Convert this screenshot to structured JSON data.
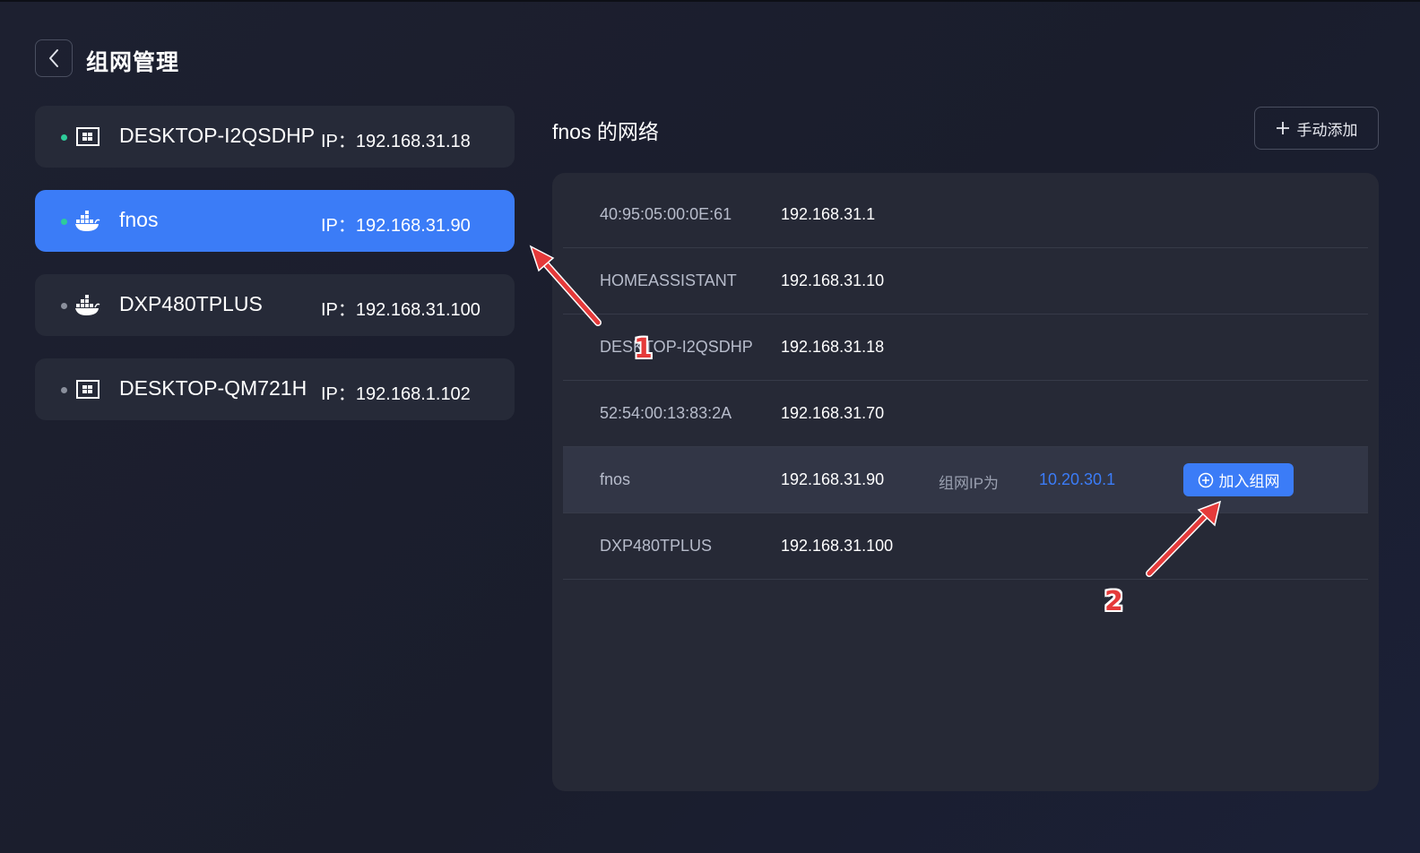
{
  "header": {
    "title": "组网管理"
  },
  "devices": [
    {
      "name": "DESKTOP-I2QSDHP",
      "ip_label": "IP：",
      "ip": "192.168.31.18",
      "icon": "windows-pc-icon",
      "status": "online",
      "active": false
    },
    {
      "name": "fnos",
      "ip_label": "IP：",
      "ip": "192.168.31.90",
      "icon": "docker-whale-icon",
      "status": "online",
      "active": true
    },
    {
      "name": "DXP480TPLUS",
      "ip_label": "IP：",
      "ip": "192.168.31.100",
      "icon": "docker-whale-icon",
      "status": "offline",
      "active": false
    },
    {
      "name": "DESKTOP-QM721H",
      "ip_label": "IP：",
      "ip": "192.168.1.102",
      "icon": "windows-pc-icon",
      "status": "offline",
      "active": false
    }
  ],
  "network": {
    "title": "fnos 的网络",
    "add_button": "手动添加",
    "rows": [
      {
        "name": "40:95:05:00:0E:61",
        "ip": "192.168.31.1"
      },
      {
        "name": "HOMEASSISTANT",
        "ip": "192.168.31.10"
      },
      {
        "name": "DESKTOP-I2QSDHP",
        "ip": "192.168.31.18"
      },
      {
        "name": "52:54:00:13:83:2A",
        "ip": "192.168.31.70"
      },
      {
        "name": "fnos",
        "ip": "192.168.31.90",
        "vnet_label": "组网IP为",
        "vnet_ip": "10.20.30.1",
        "join_button": "加入组网"
      },
      {
        "name": "DXP480TPLUS",
        "ip": "192.168.31.100"
      }
    ]
  },
  "annotations": {
    "marker_1": "1",
    "marker_2": "2"
  },
  "colors": {
    "accent": "#3b7cf7",
    "online": "#2ecc9a",
    "offline": "#8a8f9c",
    "annotation": "#e53a3a"
  }
}
